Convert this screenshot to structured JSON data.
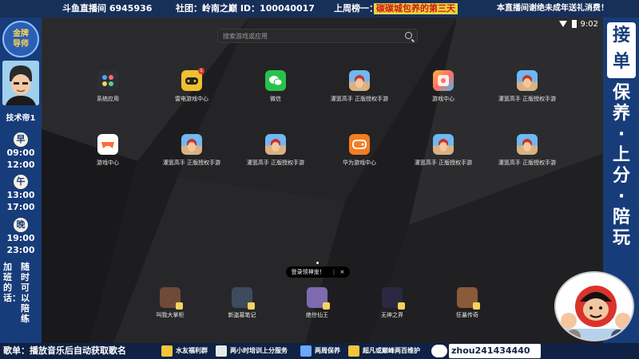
{
  "top_bar": {
    "room": "斗鱼直播间 6945936",
    "club": "社团：岭南之巅 ID：100040017",
    "last_week_label": "上周榜一：",
    "last_week_name": "碳碳城包养的第三天",
    "notice": "本直播间谢绝未成年送礼消费！"
  },
  "left_panel": {
    "badge_text": "金牌导师",
    "streamer_name": "技术帝1",
    "shifts": [
      {
        "label": "早",
        "start": "09:00",
        "end": "12:00"
      },
      {
        "label": "午",
        "start": "13:00",
        "end": "17:00"
      },
      {
        "label": "晚",
        "start": "19:00",
        "end": "23:00"
      }
    ],
    "overtime_left": "加班的话：",
    "overtime_right": "随时可以陪练"
  },
  "right_panel": {
    "accept_line1": "接",
    "accept_line2": "单",
    "services": [
      "保",
      "养",
      "·",
      "上",
      "分",
      "·",
      "陪",
      "玩"
    ]
  },
  "phone": {
    "status_time": "9:02",
    "search_placeholder": "搜索游戏或应用",
    "apps": [
      {
        "label": "系统应用",
        "icon": "system-apps-icon"
      },
      {
        "label": "雷电游戏中心",
        "icon": "thunder-game-center-icon",
        "badge": "1"
      },
      {
        "label": "微信",
        "icon": "wechat-icon"
      },
      {
        "label": "灌篮高手 正版授权手游",
        "icon": "slam-dunk-icon"
      },
      {
        "label": "游戏中心",
        "icon": "game-center-icon"
      },
      {
        "label": "灌篮高手 正版授权手游",
        "icon": "slam-dunk-icon"
      },
      {
        "label": "游戏中心",
        "icon": "gamepad-icon"
      },
      {
        "label": "灌篮高手 正版授权手游",
        "icon": "slam-dunk-icon"
      },
      {
        "label": "灌篮高手 正版授权手游",
        "icon": "slam-dunk-icon"
      },
      {
        "label": "华为游戏中心",
        "icon": "huawei-game-center-icon"
      },
      {
        "label": "灌篮高手 正版授权手游",
        "icon": "slam-dunk-icon"
      },
      {
        "label": "灌篮高手 正版授权手游",
        "icon": "slam-dunk-icon"
      }
    ],
    "toast_text": "登录领神宠！",
    "toast_close": "×",
    "dock": [
      {
        "label": "叫我大掌柜",
        "icon": "manager-game-icon",
        "color": "#6d4a3a"
      },
      {
        "label": "新盗墓笔记",
        "icon": "tomb-notes-icon",
        "color": "#3d4b5c"
      },
      {
        "label": "绝世仙王",
        "icon": "immortal-king-icon",
        "color": "#7d6ab0"
      },
      {
        "label": "无神之界",
        "icon": "godless-realm-icon",
        "color": "#2b2844"
      },
      {
        "label": "狂暴传奇",
        "icon": "rampage-legend-icon",
        "color": "#8a5a3a"
      }
    ]
  },
  "bottom_bar": {
    "song_text": "歌单：播放音乐后自动获取歌名",
    "items": [
      {
        "label": "水友福利群",
        "icon": "flag-icon"
      },
      {
        "label": "两小时培训上分服务",
        "icon": "training-icon"
      },
      {
        "label": "两周保养",
        "icon": "rocket-icon"
      },
      {
        "label": "超凡或巅峰两百维护",
        "icon": "trophy-icon"
      }
    ],
    "wechat_id": "zhou241434440"
  },
  "colors": {
    "panel_blue": "#173c7a",
    "topbar_blue": "#17305a",
    "rank_bg": "#e8d33c",
    "rank_fg": "#d01818",
    "accent_white": "#ffffff"
  }
}
